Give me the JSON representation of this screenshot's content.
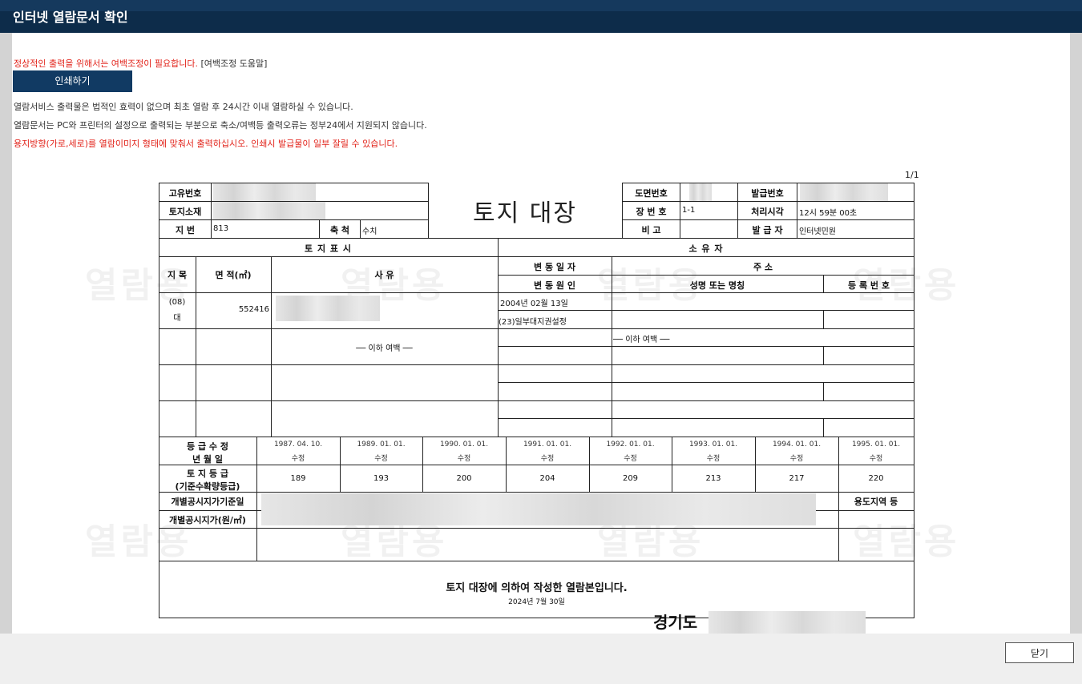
{
  "window": {
    "title": "인터넷 열람문서 확인"
  },
  "notices": {
    "margin_warning": "정상적인 출력을 위해서는 여백조정이 필요합니다.",
    "margin_help": "[여백조정 도움말]",
    "print_label": "인쇄하기",
    "line1": "열람서비스 출력물은 법적인 효력이 없으며 최초 열람 후 24시간 이내 열람하실 수 있습니다.",
    "line2": "열람문서는 PC와 프린터의 설정으로 출력되는 부분으로 축소/여백등 출력오류는 정부24에서 지원되지 않습니다.",
    "line3": "용지방향(가로,세로)를 열람이미지 형태에 맞춰서 출력하십시오. 인쇄시 발급물이 일부 잘릴 수 있습니다."
  },
  "document": {
    "page_number": "1/1",
    "title": "토지 대장",
    "watermark": "열람용",
    "header_left": {
      "unique_no_label": "고유번호",
      "location_label": "토지소재",
      "lot_no_label": "지 번",
      "lot_no_value": "813",
      "scale_label": "축 척",
      "scale_value": "수치"
    },
    "header_right": {
      "map_no_label": "도면번호",
      "issue_no_label": "발급번호",
      "sheet_no_label": "장 번 호",
      "sheet_no_value": "1-1",
      "process_time_label": "처리시각",
      "process_time_value": "12시 59분 00초",
      "remark_label": "비 고",
      "issuer_label": "발 급 자",
      "issuer_value": "인터넷민원"
    },
    "land_section": {
      "title": "토 지 표 시",
      "category_label": "지 목",
      "area_label": "면 적(㎡)",
      "reason_label": "사 유",
      "row1": {
        "category_code": "(08)",
        "category_name": "대",
        "area": "552416"
      },
      "blank_marker": "── 이하 여백 ──"
    },
    "owner_section": {
      "title": "소 유 자",
      "change_date_label": "변 동 일 자",
      "address_label": "주 소",
      "change_cause_label": "변 동 원 인",
      "name_label": "성명 또는 명칭",
      "reg_no_label": "등 록 번 호",
      "row1": {
        "change_date": "2004년 02월 13일",
        "change_cause": "(23)일부대지권설정"
      },
      "blank_marker": "── 이하 여백 ──"
    },
    "grade_section": {
      "revision_label_1": "등 급 수 정",
      "revision_label_2": "년 월 일",
      "grade_label_1": "토 지 등 급",
      "grade_label_2": "(기준수확량등급)",
      "columns": [
        {
          "date": "1987. 04. 10.",
          "note": "수정",
          "grade": "189"
        },
        {
          "date": "1989. 01. 01.",
          "note": "수정",
          "grade": "193"
        },
        {
          "date": "1990. 01. 01.",
          "note": "수정",
          "grade": "200"
        },
        {
          "date": "1991. 01. 01.",
          "note": "수정",
          "grade": "204"
        },
        {
          "date": "1992. 01. 01.",
          "note": "수정",
          "grade": "209"
        },
        {
          "date": "1993. 01. 01.",
          "note": "수정",
          "grade": "213"
        },
        {
          "date": "1994. 01. 01.",
          "note": "수정",
          "grade": "217"
        },
        {
          "date": "1995. 01. 01.",
          "note": "수정",
          "grade": "220"
        }
      ]
    },
    "price_section": {
      "base_date_label": "개별공시지가기준일",
      "price_label": "개별공시지가(원/㎡)",
      "zone_label": "용도지역 등"
    },
    "footer": {
      "statement": "토지 대장에 의하여 작성한 열람본입니다.",
      "date": "2024년 7월 30일",
      "authority": "경기도"
    }
  },
  "bottom": {
    "close_label": "닫기"
  }
}
